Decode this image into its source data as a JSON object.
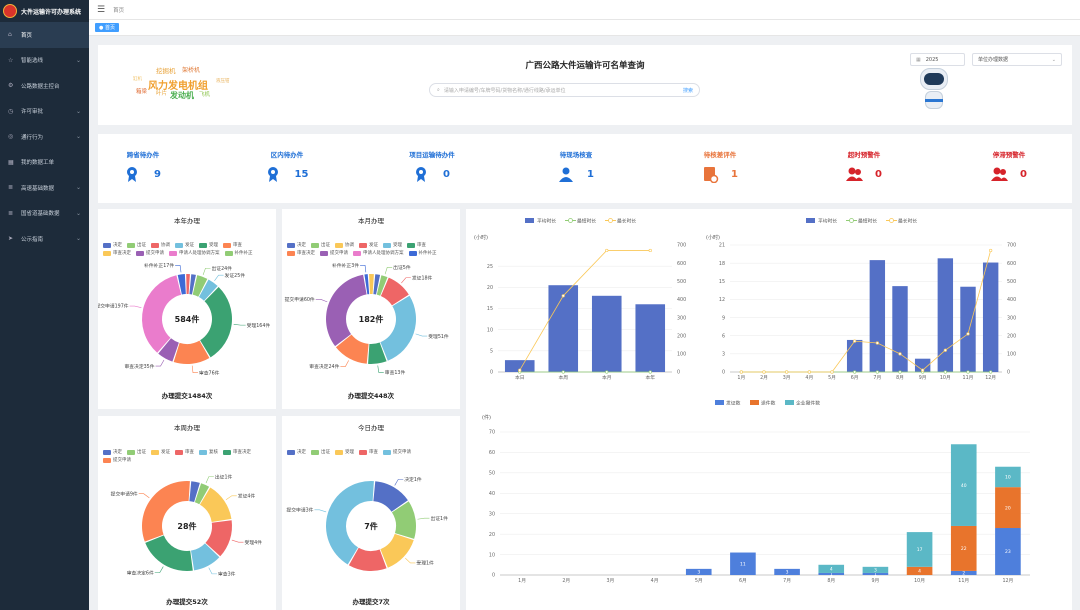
{
  "app": {
    "title": "大件运输许可办理系统"
  },
  "sidebar": {
    "items": [
      {
        "label": "首页",
        "icon": "home-icon",
        "active": true
      },
      {
        "label": "智能选线",
        "icon": "star-icon",
        "chevron": true
      },
      {
        "label": "公路数据主控台",
        "icon": "gear-icon"
      },
      {
        "label": "许可审批",
        "icon": "clock-icon",
        "chevron": true
      },
      {
        "label": "通行行为",
        "icon": "target-icon",
        "chevron": true
      },
      {
        "label": "我的数据工单",
        "icon": "grid-icon"
      },
      {
        "label": "高速基础数据",
        "icon": "list-icon",
        "chevron": true
      },
      {
        "label": "国省道基础数据",
        "icon": "list-icon",
        "chevron": true
      },
      {
        "label": "公示指南",
        "icon": "send-icon",
        "chevron": true
      }
    ]
  },
  "topbar": {
    "breadcrumb": "首页"
  },
  "tags": {
    "active": "首页"
  },
  "search": {
    "title": "广西公路大件运输许可名单查询",
    "placeholder": "请输入申请编号/车牌号码/货物名称/通行线路/承运单位",
    "button": "搜索",
    "year": "2025",
    "unit_placeholder": "单位办理数据"
  },
  "wordcloud": [
    {
      "text": "挖掘机",
      "color": "#e8a33a"
    },
    {
      "text": "架桥机",
      "color": "#e07b39"
    },
    {
      "text": "缸机",
      "color": "#f0c36a"
    },
    {
      "text": "风力发电机组",
      "color": "#f0a030"
    },
    {
      "text": "液压钳",
      "color": "#e9b562"
    },
    {
      "text": "箱梁",
      "color": "#e06b33"
    },
    {
      "text": "叶片",
      "color": "#e9a53b"
    },
    {
      "text": "发动机",
      "color": "#4caf50"
    },
    {
      "text": "飞机",
      "color": "#8bc34a"
    }
  ],
  "stats": [
    {
      "label": "跨省待办件",
      "value": "9",
      "color": "#1f6fd6",
      "icon": "medal-icon"
    },
    {
      "label": "区内待办件",
      "value": "15",
      "color": "#1f6fd6",
      "icon": "medal-icon"
    },
    {
      "label": "项目运输待办件",
      "value": "0",
      "color": "#1f6fd6",
      "icon": "medal-icon"
    },
    {
      "label": "待现场核查",
      "value": "1",
      "color": "#1f6fd6",
      "icon": "user-pin-icon"
    },
    {
      "label": "待核差评件",
      "value": "1",
      "color": "#e8743b",
      "icon": "document-clock-icon"
    },
    {
      "label": "超时预警件",
      "value": "0",
      "color": "#d6232a",
      "icon": "users-icon"
    },
    {
      "label": "停滞预警件",
      "value": "0",
      "color": "#d6232a",
      "icon": "users-icon"
    }
  ],
  "donut_colors": {
    "决定": "#5470c6",
    "出证": "#91cc75",
    "协调": "#fac858",
    "发证": "#fac858",
    "审查": "#ee6666",
    "复核": "#73c0de",
    "受理": "#3ba272",
    "审查决定": "#fc8452",
    "提交申请": "#9a60b4",
    "申请人处理协调方案": "#ea7ccc",
    "补件补正": "#3d6ad6"
  },
  "chart_data": [
    {
      "type": "pie",
      "title": "本年办理",
      "center_label": "584件",
      "footer": "办理提交1484次",
      "legend": [
        "决定",
        "出证",
        "协调",
        "发证",
        "受理",
        "审查",
        "审查决定",
        "提交申请",
        "申请人处理协调方案",
        "补件补正"
      ],
      "legend_colors": [
        "#5470c6",
        "#91cc75",
        "#ee6666",
        "#73c0de",
        "#3ba272",
        "#fc8452",
        "#fac858",
        "#9a60b4",
        "#ea7ccc",
        "#91cc75"
      ],
      "slices": [
        {
          "name": "决定",
          "label": "",
          "value": 12,
          "color": "#5470c6"
        },
        {
          "name": "出证",
          "label": "出证24件",
          "value": 24,
          "color": "#91cc75"
        },
        {
          "name": "发证",
          "label": "发证25件",
          "value": 25,
          "color": "#73c0de"
        },
        {
          "name": "受理",
          "label": "受理164件",
          "value": 164,
          "color": "#3ba272"
        },
        {
          "name": "审查",
          "label": "审查76件",
          "value": 76,
          "color": "#fc8452"
        },
        {
          "name": "审查决定",
          "label": "审查决定35件",
          "value": 35,
          "color": "#9a60b4"
        },
        {
          "name": "提交申请",
          "label": "提交申请197件",
          "value": 197,
          "color": "#ea7ccc"
        },
        {
          "name": "补件补正",
          "label": "补件补正17件",
          "value": 17,
          "color": "#3d6ad6"
        },
        {
          "name": "协调",
          "label": "",
          "value": 10,
          "color": "#ee6666"
        }
      ]
    },
    {
      "type": "pie",
      "title": "本月办理",
      "center_label": "182件",
      "footer": "办理提交448次",
      "legend": [
        "决定",
        "出证",
        "协调",
        "发证",
        "受理",
        "审查",
        "审查决定",
        "提交申请",
        "申请人处理协调方案",
        "补件补正"
      ],
      "legend_colors": [
        "#5470c6",
        "#91cc75",
        "#fac858",
        "#ee6666",
        "#73c0de",
        "#3ba272",
        "#fc8452",
        "#9a60b4",
        "#ea7ccc",
        "#3d6ad6"
      ],
      "slices": [
        {
          "name": "决定",
          "label": "",
          "value": 4,
          "color": "#5470c6"
        },
        {
          "name": "出证",
          "label": "出证5件",
          "value": 5,
          "color": "#91cc75"
        },
        {
          "name": "发证",
          "label": "发证18件",
          "value": 18,
          "color": "#ee6666"
        },
        {
          "name": "受理",
          "label": "受理51件",
          "value": 51,
          "color": "#73c0de"
        },
        {
          "name": "审查",
          "label": "审查13件",
          "value": 13,
          "color": "#3ba272"
        },
        {
          "name": "审查决定",
          "label": "审查决定24件",
          "value": 24,
          "color": "#fc8452"
        },
        {
          "name": "提交申请",
          "label": "提交申请60件",
          "value": 60,
          "color": "#9a60b4"
        },
        {
          "name": "补件补正",
          "label": "补件补正3件",
          "value": 3,
          "color": "#3d6ad6"
        },
        {
          "name": "协调",
          "label": "",
          "value": 4,
          "color": "#fac858"
        }
      ]
    },
    {
      "type": "pie",
      "title": "本周办理",
      "center_label": "28件",
      "footer": "办理提交52次",
      "legend": [
        "决定",
        "出证",
        "发证",
        "审查",
        "复核",
        "审查决定",
        "提交申请"
      ],
      "legend_colors": [
        "#5470c6",
        "#91cc75",
        "#fac858",
        "#ee6666",
        "#73c0de",
        "#3ba272",
        "#fc8452"
      ],
      "slices": [
        {
          "name": "决定",
          "label": "",
          "value": 1,
          "color": "#5470c6"
        },
        {
          "name": "出证",
          "label": "出证1件",
          "value": 1,
          "color": "#91cc75"
        },
        {
          "name": "发证",
          "label": "发证4件",
          "value": 4,
          "color": "#fac858"
        },
        {
          "name": "受理",
          "label": "受理4件",
          "value": 4,
          "color": "#ee6666"
        },
        {
          "name": "审查",
          "label": "审查3件",
          "value": 3,
          "color": "#73c0de"
        },
        {
          "name": "审查决定",
          "label": "审查决定6件",
          "value": 6,
          "color": "#3ba272"
        },
        {
          "name": "提交申请",
          "label": "提交申请9件",
          "value": 9,
          "color": "#fc8452"
        }
      ]
    },
    {
      "type": "pie",
      "title": "今日办理",
      "center_label": "7件",
      "footer": "办理提交7次",
      "legend": [
        "决定",
        "出证",
        "受理",
        "审查",
        "提交申请"
      ],
      "legend_colors": [
        "#5470c6",
        "#91cc75",
        "#fac858",
        "#ee6666",
        "#73c0de"
      ],
      "slices": [
        {
          "name": "决定",
          "label": "决定1件",
          "value": 1,
          "color": "#5470c6"
        },
        {
          "name": "出证",
          "label": "出证1件",
          "value": 1,
          "color": "#91cc75"
        },
        {
          "name": "受理",
          "label": "受理1件",
          "value": 1,
          "color": "#fac858"
        },
        {
          "name": "审查",
          "label": "",
          "value": 1,
          "color": "#ee6666"
        },
        {
          "name": "提交申请",
          "label": "提交申请3件",
          "value": 3,
          "color": "#73c0de"
        }
      ]
    },
    {
      "type": "bar",
      "ylabel": "(小时)",
      "categories": [
        "本日",
        "本周",
        "本月",
        "本年"
      ],
      "ylim": [
        0,
        30
      ],
      "y2lim": [
        0,
        700
      ],
      "series": [
        {
          "name": "平均时长",
          "values": [
            2.8,
            20.5,
            18,
            16
          ],
          "color": "#5470c6",
          "kind": "bar",
          "axis": "left"
        },
        {
          "name": "最短时长",
          "values": [
            0,
            0,
            0,
            0
          ],
          "color": "#91cc75",
          "kind": "line",
          "axis": "right"
        },
        {
          "name": "最长时长",
          "values": [
            10,
            420,
            670,
            670
          ],
          "color": "#fac858",
          "kind": "line",
          "axis": "right"
        }
      ]
    },
    {
      "type": "bar",
      "ylabel": "(小时)",
      "categories": [
        "1月",
        "2月",
        "3月",
        "4月",
        "5月",
        "6月",
        "7月",
        "8月",
        "9月",
        "10月",
        "11月",
        "12月"
      ],
      "ylim": [
        0,
        21
      ],
      "y2lim": [
        0,
        700
      ],
      "series": [
        {
          "name": "平均时长",
          "values": [
            0,
            0,
            0,
            0,
            0,
            5.3,
            18.5,
            14.2,
            2.2,
            18.8,
            14.1,
            18.1
          ],
          "color": "#5470c6",
          "kind": "bar",
          "axis": "left"
        },
        {
          "name": "最短时长",
          "values": [
            0,
            0,
            0,
            0,
            0,
            0,
            0,
            0,
            0,
            0,
            0,
            0
          ],
          "color": "#91cc75",
          "kind": "line",
          "axis": "right"
        },
        {
          "name": "最长时长",
          "values": [
            0,
            0,
            0,
            0,
            0,
            170,
            160,
            100,
            10,
            120,
            210,
            670
          ],
          "color": "#fac858",
          "kind": "line",
          "axis": "right"
        }
      ]
    },
    {
      "type": "bar",
      "ylabel": "(件)",
      "categories": [
        "1月",
        "2月",
        "3月",
        "4月",
        "5月",
        "6月",
        "7月",
        "8月",
        "9月",
        "10月",
        "11月",
        "12月"
      ],
      "ylim": [
        0,
        70
      ],
      "stacked": true,
      "series": [
        {
          "name": "发证数",
          "values": [
            0,
            0,
            0,
            0,
            3,
            11,
            3,
            1,
            1,
            0,
            2,
            23
          ],
          "labels": [
            "",
            "",
            "",
            "",
            "3",
            "11",
            "3",
            "1",
            "1",
            "",
            "2",
            "23"
          ],
          "color": "#4e7fdc"
        },
        {
          "name": "退件数",
          "values": [
            0,
            0,
            0,
            0,
            0,
            0,
            0,
            0,
            0,
            4,
            22,
            20
          ],
          "labels": [
            "",
            "",
            "",
            "",
            "",
            "",
            "",
            "",
            "",
            "4",
            "22",
            "20"
          ],
          "color": "#e8742c"
        },
        {
          "name": "企业撤件数",
          "values": [
            0,
            0,
            0,
            0,
            0,
            0,
            0,
            4,
            3,
            17,
            40,
            10
          ],
          "labels": [
            "",
            "",
            "",
            "",
            "",
            "",
            "",
            "4",
            "3",
            "17",
            "40",
            "10"
          ],
          "color": "#5bb8c6"
        }
      ]
    }
  ]
}
